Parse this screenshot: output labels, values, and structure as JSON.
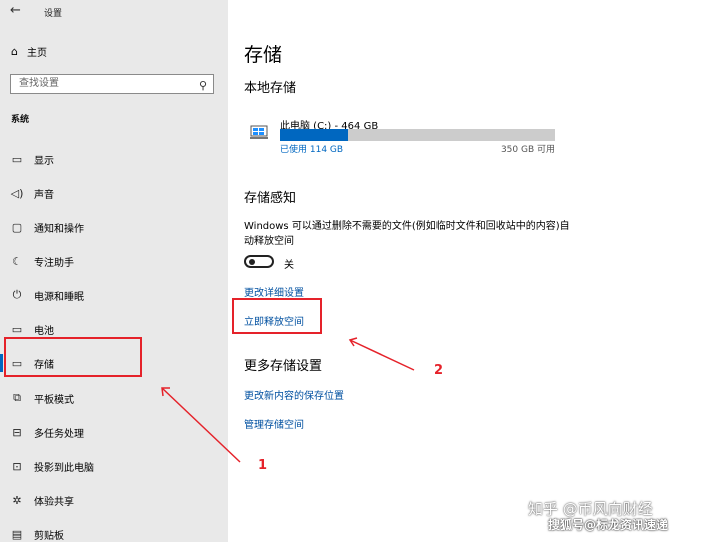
{
  "window": {
    "back_icon": "back-arrow-icon",
    "title": "设置"
  },
  "sidebar": {
    "home_label": "主页",
    "search_placeholder": "查找设置",
    "section_label": "系统",
    "items": [
      {
        "label": "显示",
        "icon": "display-icon"
      },
      {
        "label": "声音",
        "icon": "sound-icon"
      },
      {
        "label": "通知和操作",
        "icon": "notification-icon"
      },
      {
        "label": "专注助手",
        "icon": "moon-icon"
      },
      {
        "label": "电源和睡眠",
        "icon": "power-icon"
      },
      {
        "label": "电池",
        "icon": "battery-icon"
      },
      {
        "label": "存储",
        "icon": "storage-icon",
        "selected": true
      },
      {
        "label": "平板模式",
        "icon": "tablet-icon"
      },
      {
        "label": "多任务处理",
        "icon": "multitask-icon"
      },
      {
        "label": "投影到此电脑",
        "icon": "project-icon"
      },
      {
        "label": "体验共享",
        "icon": "share-icon"
      },
      {
        "label": "剪贴板",
        "icon": "clipboard-icon"
      }
    ]
  },
  "main": {
    "title": "存储",
    "local_storage": "本地存储",
    "drive": {
      "name": "此电脑 (C:) - 464 GB",
      "used_label": "已使用 114 GB",
      "free_label": "350 GB 可用",
      "used_fraction": 0.246
    },
    "sense_title": "存储感知",
    "sense_desc": "Windows 可以通过删除不需要的文件(例如临时文件和回收站中的内容)自动释放空间",
    "toggle_label": "关",
    "link_change_settings": "更改详细设置",
    "link_free_now": "立即释放空间",
    "more_title": "更多存储设置",
    "link_save_location": "更改新内容的保存位置",
    "link_manage_spaces": "管理存储空间"
  },
  "annotations": {
    "marker1": "1",
    "marker2": "2",
    "accent": "#e5222a"
  },
  "watermark": {
    "line1": "知乎 @币风向财经",
    "line2": "搜狐号@标龙资讯速递"
  }
}
